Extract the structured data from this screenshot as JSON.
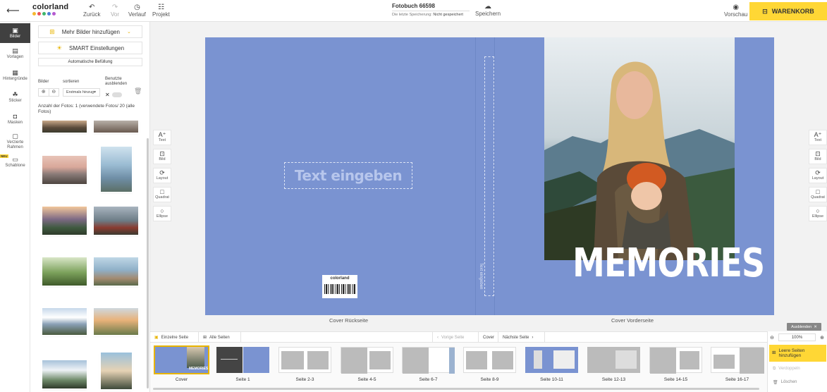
{
  "colors": {
    "accent_yellow": "#ffd735",
    "cover_blue": "#7a93d1",
    "logo_dots": [
      "#f5b82e",
      "#e8505b",
      "#3fb56b",
      "#4a7fd6",
      "#b55bd0"
    ]
  },
  "topbar": {
    "back_icon": "arrow-left-icon",
    "logo_text": "colorland",
    "undo": {
      "label": "Zurück",
      "icon": "undo-icon"
    },
    "redo": {
      "label": "Vor",
      "icon": "redo-icon"
    },
    "history": {
      "label": "Verlauf",
      "icon": "history-icon"
    },
    "project": {
      "label": "Projekt",
      "icon": "sliders-icon"
    },
    "project_title": "Fotobuch 66598",
    "last_save_label": "Die letzte Speicherung:",
    "last_save_value": "Nicht gespeichert",
    "save": {
      "label": "Speichern",
      "icon": "cloud-icon"
    },
    "preview": {
      "label": "Vorschau",
      "icon": "eye-icon"
    },
    "cart": {
      "label": "WARENKORB",
      "icon": "cart-icon"
    }
  },
  "rail": {
    "items": [
      {
        "label": "Bilder",
        "icon": "images-icon",
        "active": true
      },
      {
        "label": "Vorlagen",
        "icon": "grid-icon"
      },
      {
        "label": "Hintergründe",
        "icon": "background-icon"
      },
      {
        "label": "Sticker",
        "icon": "sticker-icon"
      },
      {
        "label": "Masken",
        "icon": "mask-icon"
      },
      {
        "label": "Verzierte Rahmen",
        "icon": "frame-icon"
      },
      {
        "label": "Schablone",
        "icon": "stencil-icon"
      }
    ],
    "new_badge": "NEU"
  },
  "panel": {
    "add_more_label": "Mehr Bilder hinzufügen",
    "smart_label": "SMART Einstellungen",
    "auto_fill_label": "Automatische Befüllung",
    "images_label": "Bilder",
    "sort_label": "sortieren",
    "hide_used_label": "Benutzte ausblenden",
    "sort_value": "Erstmals hinzug▾",
    "photo_count": "Anzahl der Fotos: 1 (verwendete Fotos/ 20 (alle Fotos)"
  },
  "tools": {
    "items": [
      {
        "label": "Text",
        "icon": "text-add-icon"
      },
      {
        "label": "Bild",
        "icon": "image-add-icon"
      },
      {
        "label": "Layout",
        "icon": "layout-icon"
      },
      {
        "label": "Quadrat",
        "icon": "square-icon"
      },
      {
        "label": "Ellipse",
        "icon": "ellipse-icon"
      }
    ]
  },
  "canvas": {
    "text_placeholder": "Text eingeben",
    "spine_placeholder": "Text eingeben",
    "barcode_logo": "colorland",
    "cover_title": "MEMORIES",
    "back_label": "Cover Rückseite",
    "front_label": "Cover Vorderseite"
  },
  "bottombar": {
    "single_pages": "Einzelne Seite",
    "all_pages": "Alle Seiten",
    "prev_page": "Vorige Seite",
    "current": "Cover",
    "next_page": "Nächste Seite",
    "hide_label": "Ausblenden",
    "zoom": "100%",
    "add_pages": "Leere Seiten hinzufügen",
    "duplicate": "Verdoppeln",
    "delete": "Löschen"
  },
  "pages": [
    "Cover",
    "Seite 1",
    "Seite 2-3",
    "Seite 4-5",
    "Seite 6-7",
    "Seite 8-9",
    "Seite 10-11",
    "Seite 12-13",
    "Seite 14-15",
    "Seite 16-17"
  ]
}
